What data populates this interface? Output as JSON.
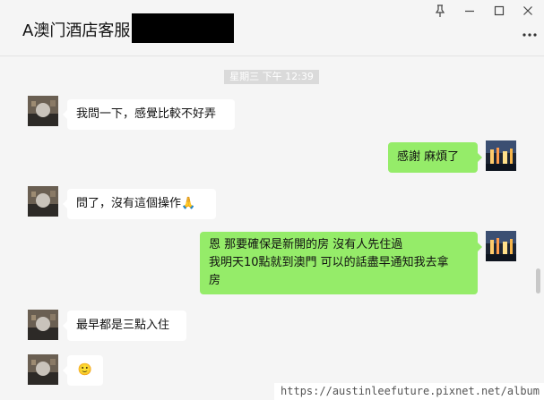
{
  "header": {
    "title": "A澳门酒店客服",
    "controls": [
      "pin-icon",
      "minimize-icon",
      "maximize-icon",
      "close-icon"
    ],
    "more_icon": "more-icon"
  },
  "chat": {
    "timestamp": "星期三 下午 12:39",
    "messages": [
      {
        "side": "left",
        "lines": [
          "我問一下，感覺比較不好弄"
        ]
      },
      {
        "side": "right",
        "lines": [
          "感謝  麻煩了"
        ]
      },
      {
        "side": "left",
        "lines": [
          "問了，沒有這個操作🙏"
        ]
      },
      {
        "side": "right",
        "lines": [
          "恩 那要確保是新開的房 沒有人先住過",
          "我明天10點就到澳門  可以的話盡早通知我去拿",
          "房"
        ]
      },
      {
        "side": "left",
        "lines": [
          "最早都是三點入住"
        ]
      },
      {
        "side": "left",
        "lines": [
          "🙂"
        ]
      }
    ]
  },
  "watermark": "https://austinleefuture.pixnet.net/album",
  "colors": {
    "self_bubble": "#95ec69",
    "other_bubble": "#ffffff",
    "chat_background": "#f5f5f5",
    "timestamp_background": "#dadada"
  }
}
